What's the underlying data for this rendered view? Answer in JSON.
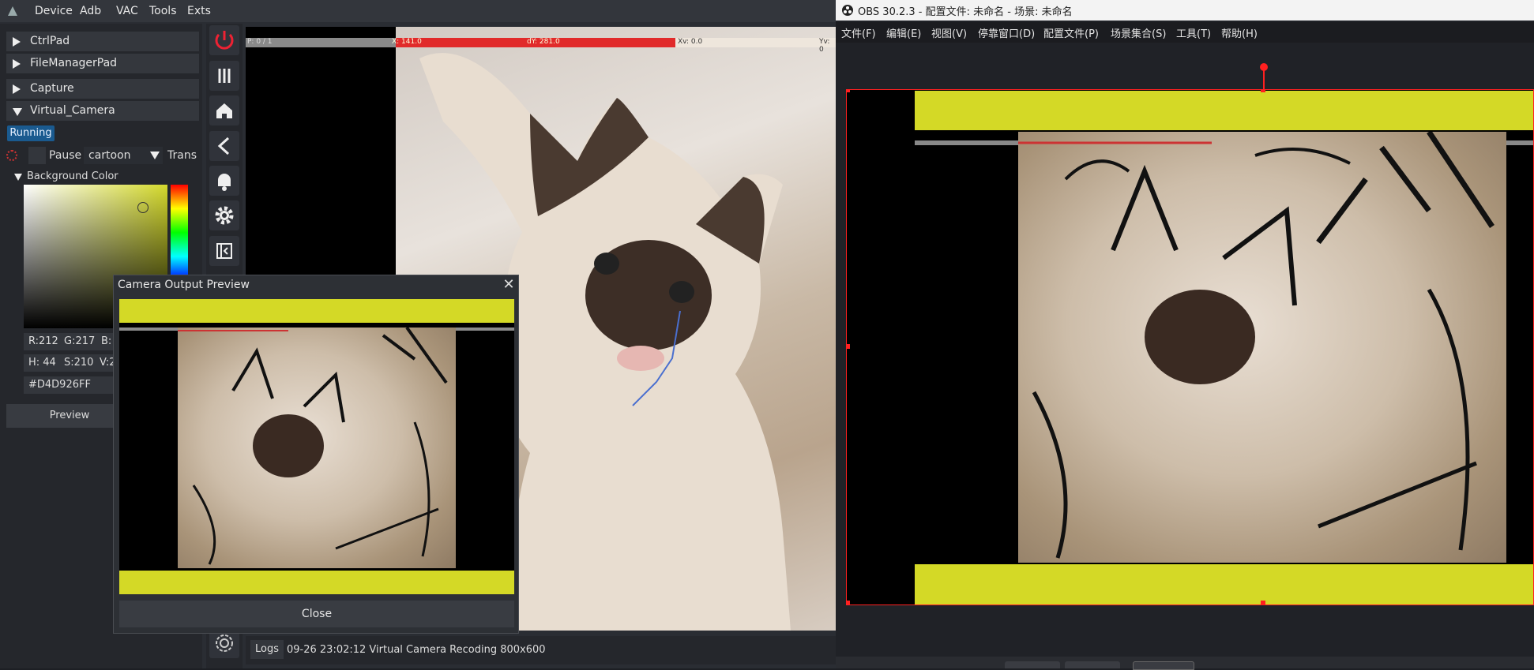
{
  "menubar": {
    "items": [
      "Device",
      "Adb",
      "VAC",
      "Tools",
      "Exts"
    ]
  },
  "panel": {
    "sections": [
      "CtrlPad",
      "FileManagerPad",
      "Capture",
      "Virtual_Camera"
    ],
    "status_badge": "Running",
    "pause_label": "Pause",
    "filter_value": "cartoon",
    "trans_label": "Trans",
    "bg_color_label": "Background Color",
    "r": "R:212",
    "g": "G:217",
    "b": "B:",
    "h": "H: 44",
    "s": "S:210",
    "v": "V:2",
    "hex": "#D4D926FF",
    "preview_btn": "Preview"
  },
  "stats": {
    "p": "P: 0 / 1",
    "x": "X: 141.0",
    "dy": "dY: 281.0",
    "xv": "Xv: 0.0",
    "yv": "Yv: 0"
  },
  "logs": {
    "button": "Logs",
    "message": "09-26 23:02:12 Virtual Camera Recoding 800x600"
  },
  "dialog": {
    "title": "Camera Output Preview",
    "close_btn": "Close"
  },
  "obs": {
    "title": "OBS 30.2.3 - 配置文件: 未命名 - 场景: 未命名",
    "menu": [
      "文件(F)",
      "编辑(E)",
      "视图(V)",
      "停靠窗口(D)",
      "配置文件(P)",
      "场景集合(S)",
      "工具(T)",
      "帮助(H)"
    ]
  },
  "colors": {
    "accent_yellow": "#D4D926",
    "selection_red": "#ff2020",
    "running_blue": "#1a5a8f"
  }
}
